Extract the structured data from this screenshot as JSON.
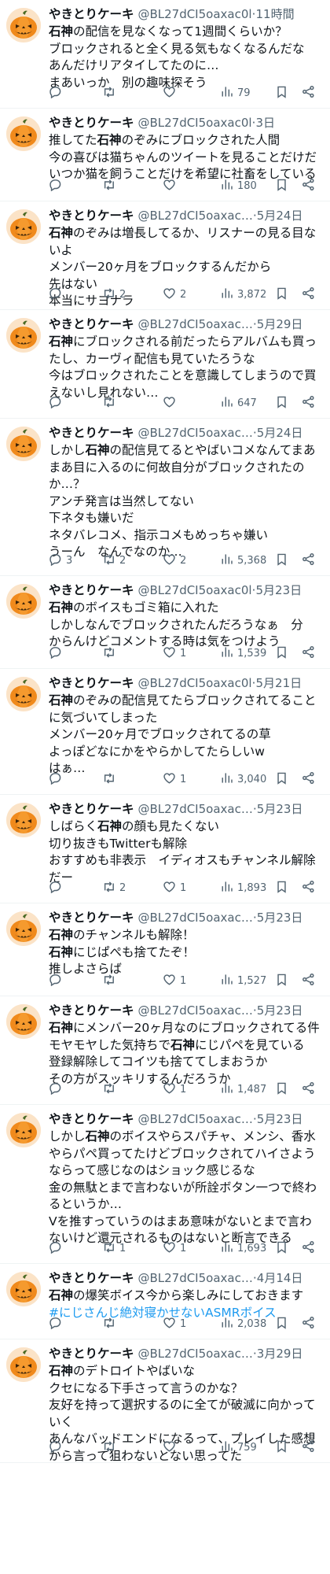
{
  "user": {
    "name": "やきとりケーキ",
    "handle": "@BL27dCI5oaxac0l",
    "handle_short": "@BL27dCI5oaxac…"
  },
  "colors": {
    "link": "#1d9bf0",
    "meta": "#536471",
    "text": "#0f1419",
    "avatar": "pumpkin"
  },
  "icons": {
    "reply": "reply-icon",
    "retweet": "retweet-icon",
    "like": "heart-icon",
    "views": "views-icon",
    "bookmark": "bookmark-icon",
    "share": "share-icon"
  },
  "tweets": [
    {
      "handle_label": "@BL27dCI5oaxac0l",
      "time": "11時間",
      "lines": [
        [
          [
            "石神",
            "b"
          ],
          [
            "の配信を見なくなって1週間くらいか？",
            ""
          ]
        ],
        [
          [
            "ブロックされると全く見る気もなくなるんだな",
            ""
          ]
        ],
        [
          [
            "あんだけリアタイしてたのに…",
            ""
          ]
        ],
        [
          [
            "まあいっか　別の趣味探そう",
            ""
          ]
        ]
      ],
      "reply": "",
      "retweet": "",
      "like": "",
      "views": "79"
    },
    {
      "handle_label": "@BL27dCI5oaxac0l",
      "time": "3日",
      "lines": [
        [
          [
            "推してた",
            ""
          ],
          [
            "石神",
            "b"
          ],
          [
            "のぞみにブロックされた人間",
            ""
          ]
        ],
        [
          [
            "今の喜びは猫ちゃんのツイートを見ることだけだ",
            ""
          ]
        ],
        [
          [
            "いつか猫を飼うことだけを希望に社畜をしている",
            ""
          ]
        ]
      ],
      "reply": "",
      "retweet": "",
      "like": "",
      "views": "180"
    },
    {
      "handle_label": "@BL27dCI5oaxac…",
      "time": "5月24日",
      "lines": [
        [
          [
            "石神",
            "b"
          ],
          [
            "のぞみは増長してるか、リスナーの見る目な",
            ""
          ]
        ],
        [
          [
            "いよ",
            ""
          ]
        ],
        [
          [
            "メンバー20ヶ月をブロックするんだから",
            ""
          ]
        ],
        [
          [
            "先はない",
            ""
          ]
        ],
        [
          [
            "本当にサヨナラ",
            ""
          ]
        ]
      ],
      "reply": "",
      "retweet": "2",
      "like": "2",
      "views": "3,872"
    },
    {
      "handle_label": "@BL27dCI5oaxac…",
      "time": "5月29日",
      "lines": [
        [
          [
            "石神",
            "b"
          ],
          [
            "にブロックされる前だったらアルバムも買っ",
            ""
          ]
        ],
        [
          [
            "たし、カーヴィ配信も見ていたろうな",
            ""
          ]
        ],
        [
          [
            "今はブロックされたことを意識してしまうので買",
            ""
          ]
        ],
        [
          [
            "えないし見れない…",
            ""
          ]
        ]
      ],
      "reply": "",
      "retweet": "",
      "like": "",
      "views": "647"
    },
    {
      "handle_label": "@BL27dCI5oaxac…",
      "time": "5月24日",
      "lines": [
        [
          [
            "しかし",
            ""
          ],
          [
            "石神",
            "b"
          ],
          [
            "の配信見てるとやばいコメなんてまあ",
            ""
          ]
        ],
        [
          [
            "まあ目に入るのに何故自分がブロックされたの",
            ""
          ]
        ],
        [
          [
            "か…？",
            ""
          ]
        ],
        [
          [
            "アンチ発言は当然してない",
            ""
          ]
        ],
        [
          [
            "下ネタも嫌いだ",
            ""
          ]
        ],
        [
          [
            "ネタバレコメ、指示コメもめっちゃ嫌い",
            ""
          ]
        ],
        [
          [
            "うーん　なんでなのか…",
            ""
          ]
        ]
      ],
      "reply": "3",
      "retweet": "2",
      "like": "2",
      "views": "5,368"
    },
    {
      "handle_label": "@BL27dCI5oaxac0l",
      "time": "5月23日",
      "lines": [
        [
          [
            "石神",
            "b"
          ],
          [
            "のボイスもゴミ箱に入れた",
            ""
          ]
        ],
        [
          [
            "しかしなんでブロックされたんだろうなぁ　分",
            ""
          ]
        ],
        [
          [
            "からんけどコメントする時は気をつけよう",
            ""
          ]
        ]
      ],
      "reply": "",
      "retweet": "",
      "like": "1",
      "views": "1,539"
    },
    {
      "handle_label": "@BL27dCI5oaxac0l",
      "time": "5月21日",
      "lines": [
        [
          [
            "石神",
            "b"
          ],
          [
            "のぞみの配信見てたらブロックされてること",
            ""
          ]
        ],
        [
          [
            "に気づいてしまった",
            ""
          ]
        ],
        [
          [
            "メンバー20ヶ月でブロックされてるの草",
            ""
          ]
        ],
        [
          [
            "よっぽどなにかをやらかしてたらしいw",
            ""
          ]
        ],
        [
          [
            "はぁ…",
            ""
          ]
        ]
      ],
      "reply": "",
      "retweet": "",
      "like": "1",
      "views": "3,040"
    },
    {
      "handle_label": "@BL27dCI5oaxac…",
      "time": "5月23日",
      "lines": [
        [
          [
            "しばらく",
            ""
          ],
          [
            "石神",
            "b"
          ],
          [
            "の顔も見たくない",
            ""
          ]
        ],
        [
          [
            "切り抜きもTwitterも解除",
            ""
          ]
        ],
        [
          [
            "おすすめも非表示　イディオスもチャンネル解除",
            ""
          ]
        ],
        [
          [
            "だー",
            ""
          ]
        ]
      ],
      "reply": "",
      "retweet": "2",
      "like": "1",
      "views": "1,893"
    },
    {
      "handle_label": "@BL27dCI5oaxac…",
      "time": "5月23日",
      "lines": [
        [
          [
            "石神",
            "b"
          ],
          [
            "のチャンネルも解除！",
            ""
          ]
        ],
        [
          [
            "石神",
            "b"
          ],
          [
            "にじぱぺも捨てたぞ！",
            ""
          ]
        ],
        [
          [
            "推しよさらば",
            ""
          ]
        ]
      ],
      "reply": "",
      "retweet": "",
      "like": "1",
      "views": "1,527"
    },
    {
      "handle_label": "@BL27dCI5oaxac…",
      "time": "5月23日",
      "lines": [
        [
          [
            "石神",
            "b"
          ],
          [
            "にメンバー20ヶ月なのにブロックされてる件",
            ""
          ]
        ],
        [
          [
            "モヤモヤした気持ちで",
            ""
          ],
          [
            "石神",
            "b"
          ],
          [
            "にじパペを見ている",
            ""
          ]
        ],
        [
          [
            "登録解除してコイツも捨ててしまおうか",
            ""
          ]
        ],
        [
          [
            "その方がスッキリするんだろうか",
            ""
          ]
        ]
      ],
      "reply": "",
      "retweet": "",
      "like": "1",
      "views": "1,487"
    },
    {
      "handle_label": "@BL27dCI5oaxac…",
      "time": "5月23日",
      "lines": [
        [
          [
            "しかし",
            ""
          ],
          [
            "石神",
            "b"
          ],
          [
            "のボイスやらスパチャ、メンシ、香水",
            ""
          ]
        ],
        [
          [
            "やらパペ買ってたけどブロックされてハイさよう",
            ""
          ]
        ],
        [
          [
            "ならって感じなのはショック感じるな",
            ""
          ]
        ],
        [
          [
            "金の無駄とまで言わないが所詮ボタン一つで終わ",
            ""
          ]
        ],
        [
          [
            "るというか…",
            ""
          ]
        ],
        [
          [
            "Vを推すっていうのはまあ意味がないとまで言わ",
            ""
          ]
        ],
        [
          [
            "ないけど還元されるものはないと断言できる",
            ""
          ]
        ]
      ],
      "reply": "",
      "retweet": "1",
      "like": "1",
      "views": "1,693"
    },
    {
      "handle_label": "@BL27dCI5oaxac…",
      "time": "4月14日",
      "lines": [
        [
          [
            "石神",
            "b"
          ],
          [
            "の爆笑ボイス今から楽しみにしておきます",
            ""
          ]
        ],
        [
          [
            "#にじさんじ絶対寝かせないASMRボイス",
            "t"
          ]
        ]
      ],
      "reply": "",
      "retweet": "",
      "like": "1",
      "views": "2,038"
    },
    {
      "handle_label": "@BL27dCI5oaxac…",
      "time": "3月29日",
      "lines": [
        [
          [
            "石神",
            "b"
          ],
          [
            "のデトロイトやばいな",
            ""
          ]
        ],
        [
          [
            "クセになる下手さって言うのかな？",
            ""
          ]
        ],
        [
          [
            "友好を持って選択するのに全てが破滅に向かって",
            ""
          ]
        ],
        [
          [
            "いく",
            ""
          ]
        ],
        [
          [
            "あんなバッドエンドになるって、プレイした感想",
            ""
          ]
        ],
        [
          [
            "から言って狙わないとない思ってた",
            ""
          ]
        ]
      ],
      "reply": "",
      "retweet": "",
      "like": "",
      "views": "759"
    }
  ]
}
